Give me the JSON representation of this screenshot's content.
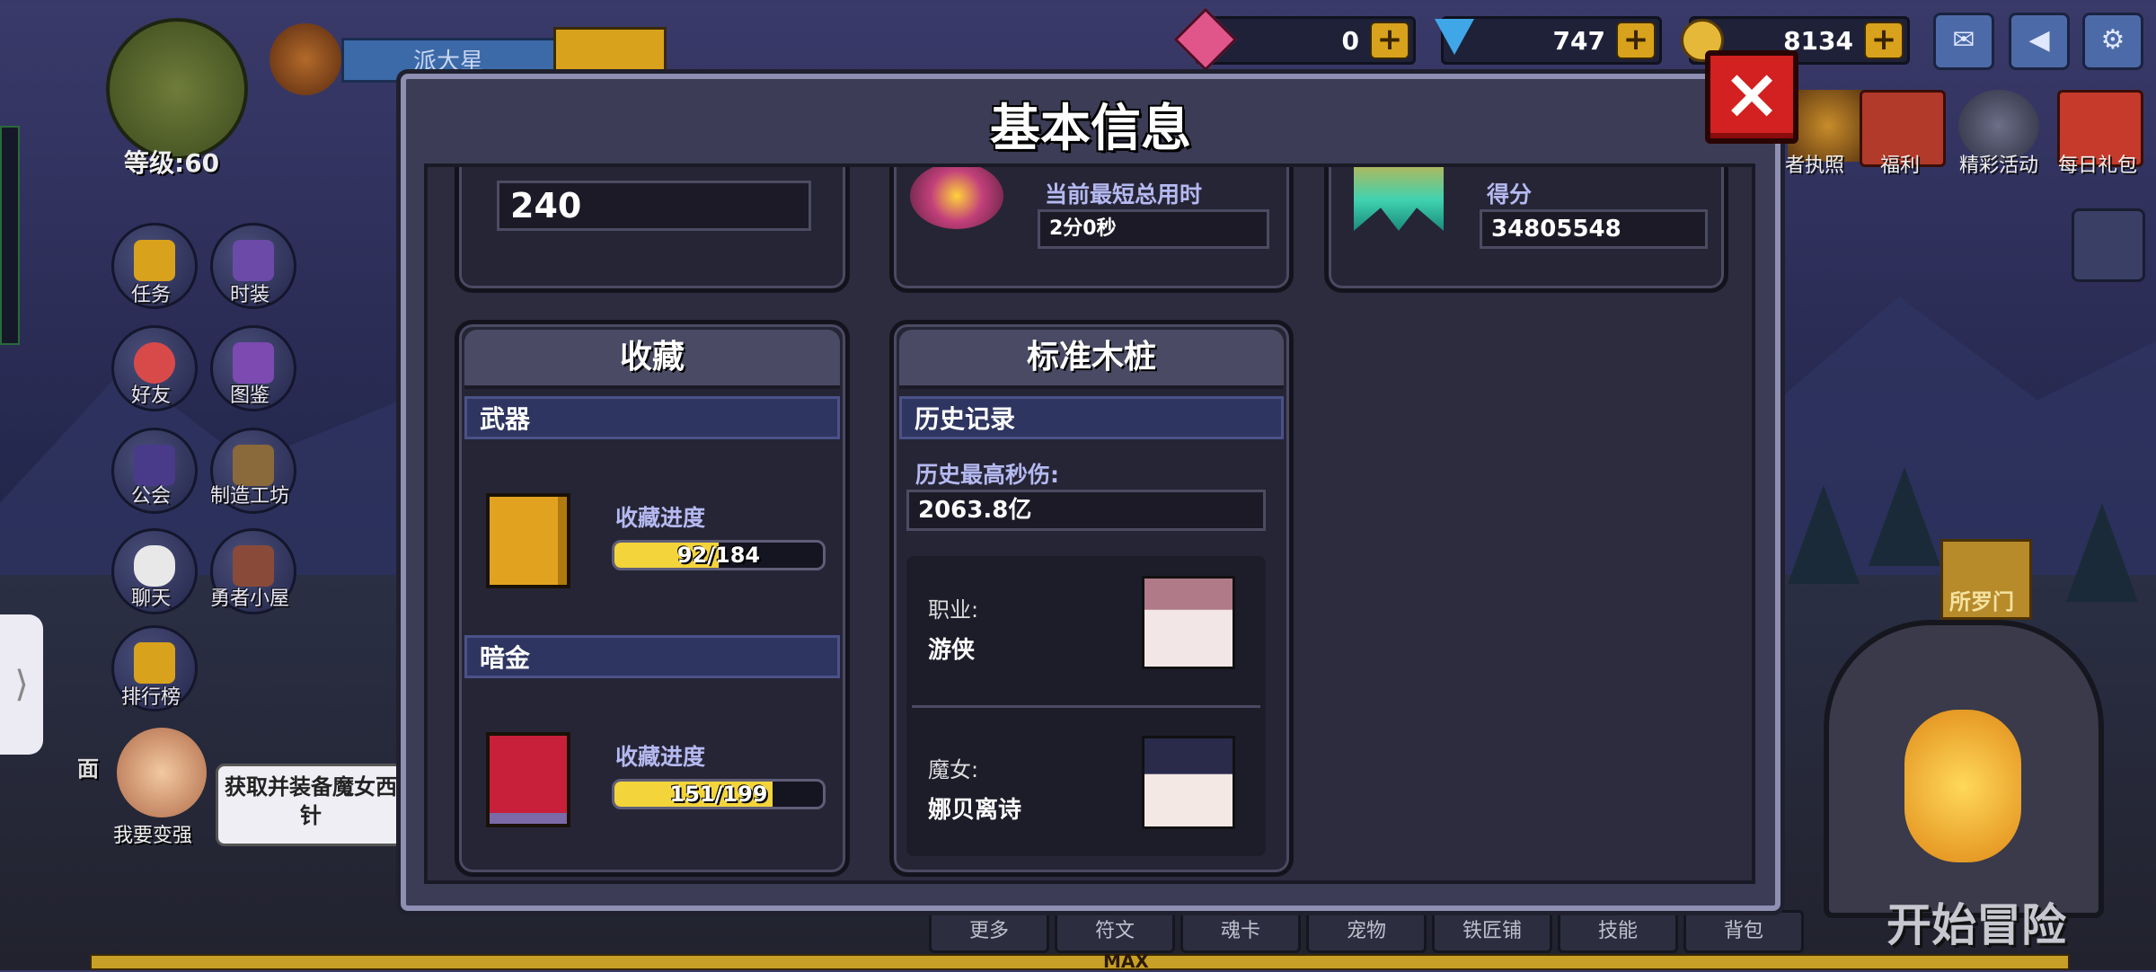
{
  "player": {
    "name": "派大星",
    "level_text": "等级:60"
  },
  "currencies": [
    {
      "icon": "heart-gem-icon",
      "value": "0",
      "color": "#e0568a"
    },
    {
      "icon": "diamond-icon",
      "value": "747",
      "color": "#3fa7e8"
    },
    {
      "icon": "coin-icon",
      "value": "8134",
      "color": "#e6b83a"
    }
  ],
  "top_icons": [
    "mail-icon",
    "announcement-icon",
    "settings-gear-icon"
  ],
  "events": [
    {
      "label": "者执照",
      "icon": "license-icon"
    },
    {
      "label": "福利",
      "icon": "welfare-icon"
    },
    {
      "label": "精彩活动",
      "icon": "event-icon"
    },
    {
      "label": "每日礼包",
      "icon": "daily-gift-icon"
    }
  ],
  "side_menu": [
    {
      "label": "任务",
      "icon": "quest-icon"
    },
    {
      "label": "时装",
      "icon": "fashion-icon"
    },
    {
      "label": "好友",
      "icon": "friends-icon"
    },
    {
      "label": "图鉴",
      "icon": "codex-icon"
    },
    {
      "label": "公会",
      "icon": "guild-icon"
    },
    {
      "label": "制造工坊",
      "icon": "workshop-icon"
    },
    {
      "label": "聊天",
      "icon": "chat-icon"
    },
    {
      "label": "勇者小屋",
      "icon": "hero-house-icon"
    },
    {
      "label": "排行榜",
      "icon": "leaderboard-icon"
    }
  ],
  "hint_text": "获取并装备魔女西\n针",
  "become_stronger": "我要变强",
  "face_label": "面",
  "portal_label": "所罗门",
  "start_button": "开始冒险",
  "bottom_tabs": [
    "更多",
    "符文",
    "魂卡",
    "宠物",
    "铁匠铺",
    "技能",
    "背包"
  ],
  "max_label": "MAX",
  "dialog": {
    "title": "基本信息",
    "top_row": {
      "left_value": "240",
      "mid_label": "当前最短总用时",
      "mid_value": "2分0秒",
      "right_label": "得分",
      "right_value": "34805548"
    },
    "collection": {
      "title": "收藏",
      "sections": [
        {
          "name": "武器",
          "progress_label": "收藏进度",
          "current": 92,
          "total": 184,
          "text": "92/184",
          "book_color": "#e1a31f"
        },
        {
          "name": "暗金",
          "progress_label": "收藏进度",
          "current": 151,
          "total": 199,
          "text": "151/199",
          "book_color": "#c8203a"
        }
      ]
    },
    "dummy": {
      "title": "标准木桩",
      "history_bar": "历史记录",
      "max_dps_label": "历史最高秒伤:",
      "max_dps_value": "2063.8亿",
      "class_label": "职业:",
      "class_value": "游侠",
      "witch_label": "魔女:",
      "witch_value": "娜贝离诗"
    }
  }
}
